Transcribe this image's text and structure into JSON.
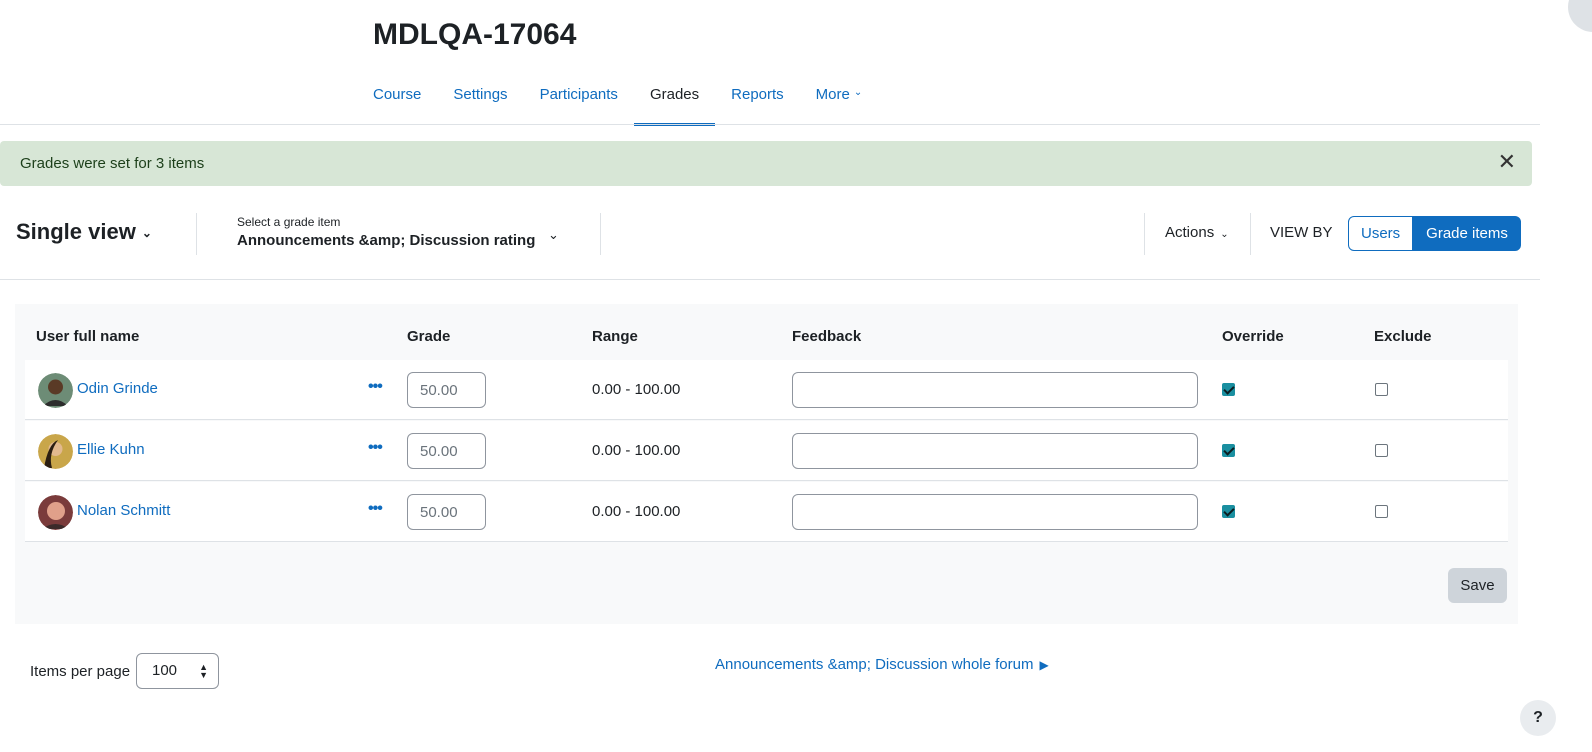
{
  "page": {
    "title": "MDLQA-17064"
  },
  "nav": {
    "tabs": [
      {
        "label": "Course"
      },
      {
        "label": "Settings"
      },
      {
        "label": "Participants"
      },
      {
        "label": "Grades",
        "active": true
      },
      {
        "label": "Reports"
      },
      {
        "label": "More"
      }
    ]
  },
  "alert": {
    "message": "Grades were set for 3 items",
    "close": "✕"
  },
  "toolbar": {
    "view_label": "Single view",
    "grade_item_caption": "Select a grade item",
    "grade_item_value": "Announcements &amp; Discussion rating",
    "actions_label": "Actions",
    "view_by_label": "VIEW BY",
    "users_button": "Users",
    "grade_items_button": "Grade items"
  },
  "table": {
    "headers": {
      "name": "User full name",
      "grade": "Grade",
      "range": "Range",
      "feedback": "Feedback",
      "override": "Override",
      "exclude": "Exclude"
    },
    "rows": [
      {
        "name": "Odin Grinde",
        "grade": "50.00",
        "range": "0.00 - 100.00",
        "feedback": "",
        "override": true,
        "exclude": false
      },
      {
        "name": "Ellie Kuhn",
        "grade": "50.00",
        "range": "0.00 - 100.00",
        "feedback": "",
        "override": true,
        "exclude": false
      },
      {
        "name": "Nolan Schmitt",
        "grade": "50.00",
        "range": "0.00 - 100.00",
        "feedback": "",
        "override": true,
        "exclude": false
      }
    ],
    "save_label": "Save"
  },
  "footer": {
    "items_per_page_label": "Items per page",
    "items_per_page_value": "100",
    "next_link": "Announcements &amp; Discussion whole forum"
  },
  "help": {
    "label": "?"
  },
  "colors": {
    "link": "#0f6cbf",
    "alert_bg": "#d7e6d6",
    "checkbox_on": "#1a8fa0",
    "panel_bg": "#f8f9fa"
  },
  "icons": [
    "chevron-down-icon",
    "close-icon",
    "more-dots-icon",
    "caret-right-icon",
    "sort-arrows-icon",
    "help-icon"
  ]
}
